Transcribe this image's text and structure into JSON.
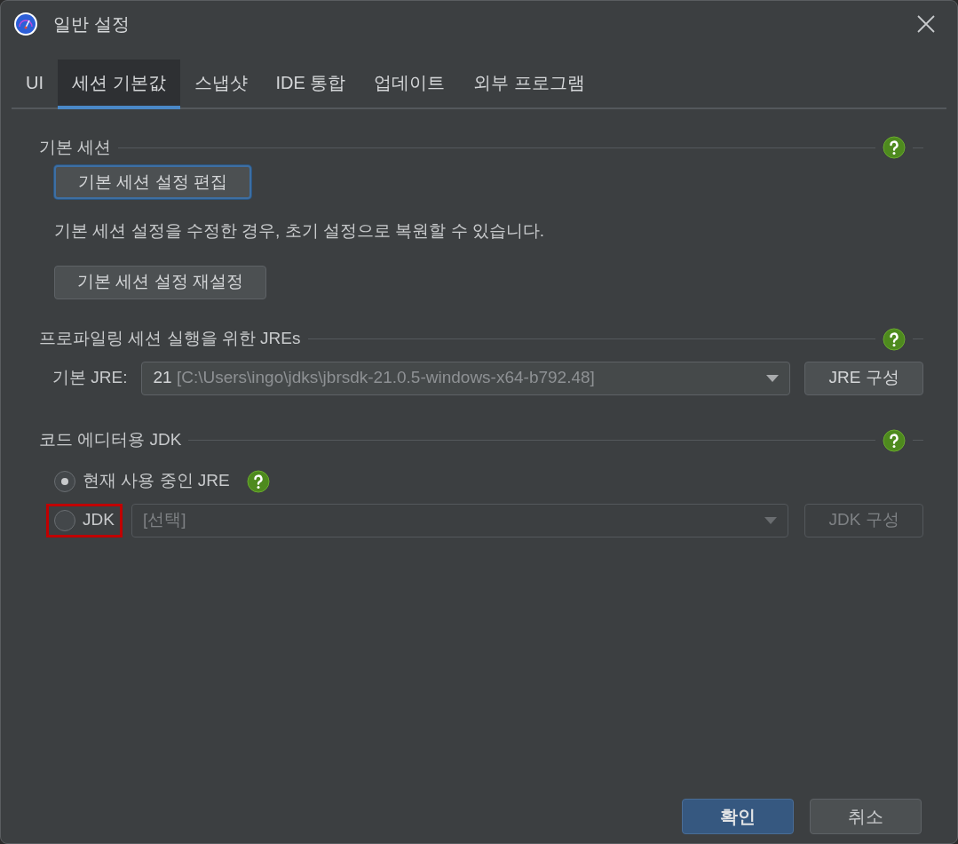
{
  "window": {
    "title": "일반 설정"
  },
  "tabs": [
    {
      "label": "UI",
      "selected": false
    },
    {
      "label": "세션 기본값",
      "selected": true
    },
    {
      "label": "스냅샷",
      "selected": false
    },
    {
      "label": "IDE 통합",
      "selected": false
    },
    {
      "label": "업데이트",
      "selected": false
    },
    {
      "label": "외부 프로그램",
      "selected": false
    }
  ],
  "default_session": {
    "title": "기본 세션",
    "edit_button": {
      "label": "기본 세션 설정 편집",
      "focused": true
    },
    "description": "기본 세션 설정을 수정한 경우, 초기 설정으로 복원할 수 있습니다.",
    "reset_button": {
      "label": "기본 세션 설정 재설정",
      "focused": false
    }
  },
  "profiling_jres": {
    "title": "프로파일링 세션 실행을 위한 JREs",
    "label": "기본 JRE:",
    "select": {
      "value": "21",
      "detail": "[C:\\Users\\ingo\\jdks\\jbrsdk-21.0.5-windows-x64-b792.48]",
      "disabled": false
    },
    "button": {
      "label": "JRE 구성",
      "disabled": false
    }
  },
  "editor_jdk": {
    "title": "코드 에디터용 JDK",
    "options": [
      {
        "kind": "plain",
        "label": "현재 사용 중인 JRE",
        "selected": true
      },
      {
        "kind": "jdk",
        "label": "JDK",
        "selected": false,
        "color": "#c00000",
        "select": {
          "value": "[선택]",
          "disabled": true
        },
        "button": {
          "label": "JDK 구성",
          "disabled": true
        }
      }
    ]
  },
  "buttons": [
    {
      "label": "확인",
      "default": true
    },
    {
      "label": "취소",
      "default": false
    }
  ]
}
